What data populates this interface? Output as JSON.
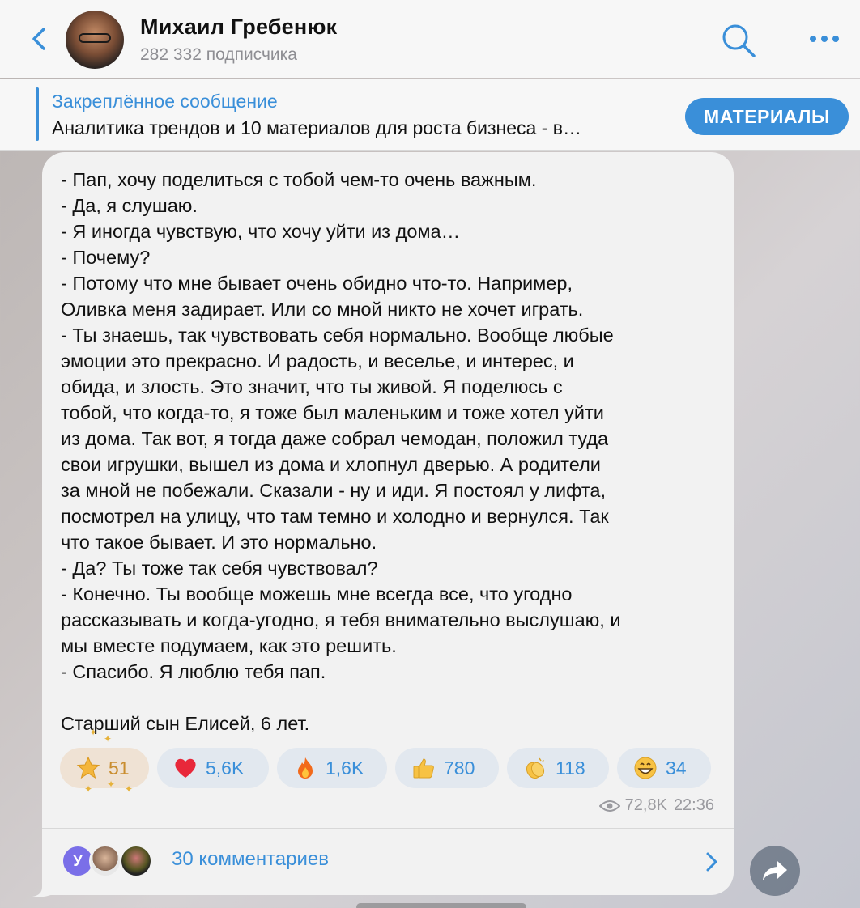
{
  "header": {
    "title": "Михаил Гребенюк",
    "subtitle": "282 332 подписчика"
  },
  "pinned": {
    "title": "Закреплённое сообщение",
    "text": "Аналитика трендов и 10 материалов для роста бизнеса - в…",
    "button_label": "МАТЕРИАЛЫ"
  },
  "message": {
    "lines": [
      "- Пап, хочу поделиться с тобой чем-то очень важным.",
      "- Да, я слушаю.",
      "- Я иногда чувствую, что хочу уйти из дома…",
      "- Почему?",
      "- Потому что мне бывает очень обидно что-то. Например,",
      "Оливка меня задирает. Или со мной никто не хочет играть.",
      "- Ты знаешь, так чувствовать себя нормально. Вообще любые",
      "эмоции это прекрасно. И радость, и веселье, и интерес, и",
      "обида, и злость. Это значит, что ты живой. Я поделюсь с",
      "тобой, что когда-то, я тоже был маленьким и тоже хотел уйти",
      "из дома. Так вот, я тогда даже собрал чемодан, положил туда",
      "свои игрушки, вышел из дома и хлопнул дверью. А родители",
      "за мной не побежали. Сказали - ну и иди. Я постоял у лифта,",
      "посмотрел на улицу, что там темно и холодно и вернулся. Так",
      "что такое бывает. И это нормально.",
      "- Да? Ты тоже так себя чувствовал?",
      "- Конечно. Ты вообще можешь мне всегда все, что угодно",
      "рассказывать и когда-угодно, я тебя внимательно выслушаю, и",
      "мы вместе подумаем, как это решить.",
      "- Спасибо. Я люблю тебя пап.",
      "",
      "Старший сын Елисей, 6 лет."
    ],
    "reactions": [
      {
        "emoji": "star-icon",
        "count": "51"
      },
      {
        "emoji": "heart-icon",
        "count": "5,6K"
      },
      {
        "emoji": "fire-icon",
        "count": "1,6K"
      },
      {
        "emoji": "thumbs-up-icon",
        "count": "780"
      },
      {
        "emoji": "clapping-hands-icon",
        "count": "118"
      },
      {
        "emoji": "grinning-face-icon",
        "count": "34"
      }
    ],
    "views": "72,8K",
    "time": "22:36"
  },
  "comments": {
    "avatar_initial": "У",
    "label": "30 комментариев"
  },
  "colors": {
    "accent": "#3a8fd9",
    "star_reaction_text": "#c98d2f",
    "bubble_bg": "#f2f2f2"
  }
}
